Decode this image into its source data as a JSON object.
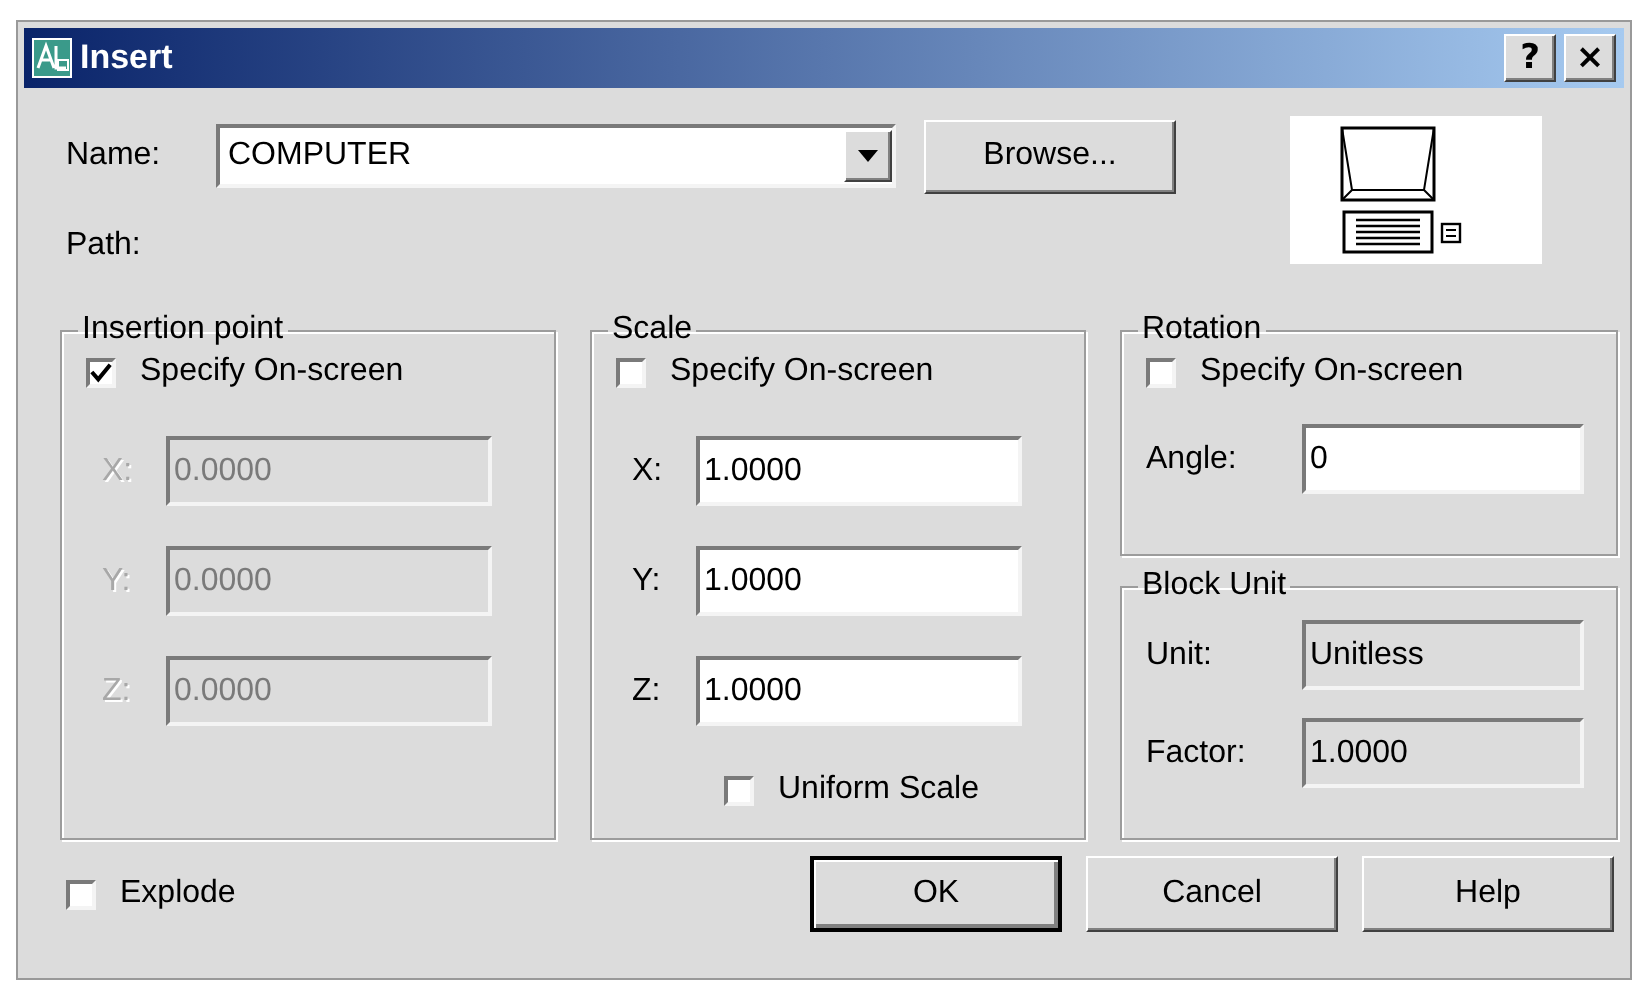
{
  "window": {
    "title": "Insert",
    "help_button": "?",
    "close_button": "×"
  },
  "name": {
    "label": "Name:",
    "value": "COMPUTER"
  },
  "browse_button": "Browse...",
  "path": {
    "label": "Path:"
  },
  "insertion_point": {
    "title": "Insertion point",
    "specify_on_screen": {
      "label": "Specify On-screen",
      "checked": true
    },
    "fields": [
      {
        "label": "X:",
        "value": "0.0000",
        "disabled": true
      },
      {
        "label": "Y:",
        "value": "0.0000",
        "disabled": true
      },
      {
        "label": "Z:",
        "value": "0.0000",
        "disabled": true
      }
    ]
  },
  "scale": {
    "title": "Scale",
    "specify_on_screen": {
      "label": "Specify On-screen",
      "checked": false
    },
    "fields": [
      {
        "label": "X:",
        "value": "1.0000",
        "disabled": false
      },
      {
        "label": "Y:",
        "value": "1.0000",
        "disabled": false
      },
      {
        "label": "Z:",
        "value": "1.0000",
        "disabled": false
      }
    ],
    "uniform_scale": {
      "label": "Uniform Scale",
      "checked": false
    }
  },
  "rotation": {
    "title": "Rotation",
    "specify_on_screen": {
      "label": "Specify On-screen",
      "checked": false
    },
    "angle": {
      "label": "Angle:",
      "value": "0",
      "disabled": false
    }
  },
  "block_unit": {
    "title": "Block Unit",
    "fields": [
      {
        "label": "Unit:",
        "value": "Unitless",
        "disabled": true
      },
      {
        "label": "Factor:",
        "value": "1.0000",
        "disabled": true
      }
    ]
  },
  "explode": {
    "label": "Explode",
    "checked": false
  },
  "buttons": [
    {
      "label": "OK",
      "default": true
    },
    {
      "label": "Cancel",
      "default": false
    },
    {
      "label": "Help",
      "default": false
    }
  ]
}
